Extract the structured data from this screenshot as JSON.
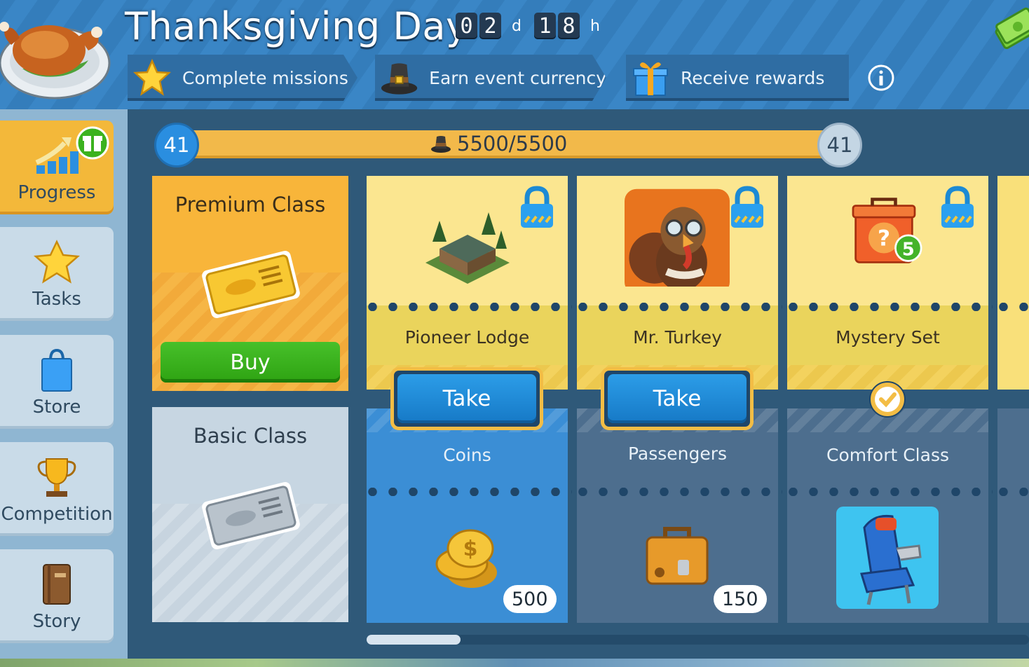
{
  "header": {
    "title": "Thanksgiving Day",
    "timer": {
      "days_digits": [
        "0",
        "2"
      ],
      "days_unit": "d",
      "hours_digits": [
        "1",
        "8"
      ],
      "hours_unit": "h"
    },
    "steps": [
      {
        "label": "Complete missions",
        "icon": "star-icon"
      },
      {
        "label": "Earn event currency",
        "icon": "pilgrim-hat-icon"
      },
      {
        "label": "Receive rewards",
        "icon": "gift-box-icon"
      }
    ],
    "info_icon": "info-icon",
    "currency_icon": "money-stack-icon"
  },
  "sidebar": {
    "items": [
      {
        "label": "Progress",
        "icon": "progress-chart-icon",
        "active": true
      },
      {
        "label": "Tasks",
        "icon": "star-icon"
      },
      {
        "label": "Store",
        "icon": "shopping-bag-icon"
      },
      {
        "label": "Competition",
        "icon": "trophy-icon"
      },
      {
        "label": "Story",
        "icon": "book-icon"
      }
    ]
  },
  "progress": {
    "level_current": "41",
    "level_next": "41",
    "points_text": "5500/5500",
    "fill_fraction": 1.0
  },
  "classes": {
    "premium": {
      "title": "Premium Class",
      "buy_label": "Buy"
    },
    "basic": {
      "title": "Basic Class"
    }
  },
  "rewards": [
    {
      "premium": {
        "name": "Pioneer Lodge",
        "icon": "lodge-icon",
        "locked": true
      },
      "action": "Take",
      "basic": {
        "name": "Coins",
        "icon": "coins-icon",
        "quantity": "500"
      }
    },
    {
      "premium": {
        "name": "Mr. Turkey",
        "icon": "turkey-pilot-icon",
        "locked": true
      },
      "action": "Take",
      "basic": {
        "name": "Passengers",
        "icon": "suitcase-icon",
        "quantity": "150"
      }
    },
    {
      "premium": {
        "name": "Mystery Set",
        "icon": "mystery-box-icon",
        "locked": true,
        "badge": "5"
      },
      "action": "claimed",
      "basic": {
        "name": "Comfort Class",
        "icon": "airplane-seat-icon"
      }
    }
  ],
  "colors": {
    "header_blue": "#3a86c6",
    "premium_orange": "#f8b53a",
    "take_blue": "#1f86d6",
    "buy_green": "#3bb21e",
    "progress_gold": "#f2b94a"
  }
}
